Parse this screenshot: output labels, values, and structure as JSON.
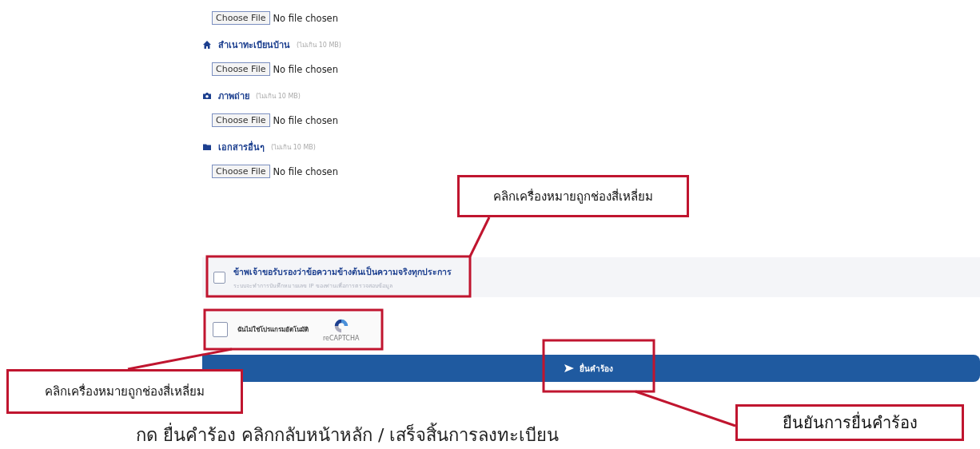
{
  "uploads": [
    {
      "button": "Choose File",
      "status": "No file chosen"
    },
    {
      "kind": "home",
      "label": "สำเนาทะเบียนบ้าน",
      "note": "(ไม่เกิน 10 MB)",
      "button": "Choose File",
      "status": "No file chosen"
    },
    {
      "kind": "camera",
      "label": "ภาพถ่าย",
      "note": "(ไม่เกิน 10 MB)",
      "button": "Choose File",
      "status": "No file chosen"
    },
    {
      "kind": "folder",
      "label": "เอกสารอื่นๆ",
      "note": "(ไม่เกิน 10 MB)",
      "button": "Choose File",
      "status": "No file chosen"
    }
  ],
  "certify": {
    "checked": false,
    "label": "ข้าพเจ้าขอรับรองว่าข้อความข้างต้นเป็นความจริงทุกประการ",
    "hint": "ระบบจะทำการบันทึกหมายเลข IP ของท่านเพื่อการตรวจสอบข้อมูล"
  },
  "captcha": {
    "checked": false,
    "label": "ฉันไม่ใช่โปรแกรมอัตโนมัติ",
    "brand": "reCAPTCHA"
  },
  "submit": {
    "label": "ยื่นคำร้อง"
  },
  "callouts": [
    "คลิกเครื่องหมายถูกช่องสี่เหลี่ยม",
    "คลิกเครื่องหมายถูกช่องสี่เหลี่ยม",
    "ยืนยันการยื่นคำร้อง"
  ],
  "caption": "กด ยื่นคำร้อง คลิกกลับหน้าหลัก / เสร็จสิ้นการลงทะเบียน"
}
